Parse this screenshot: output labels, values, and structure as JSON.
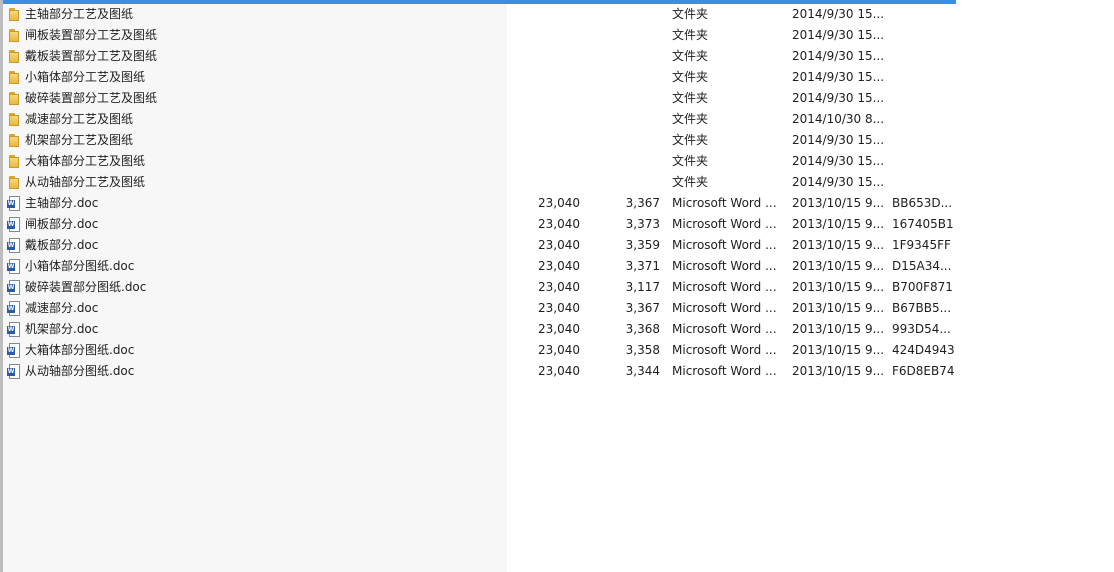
{
  "files": [
    {
      "kind": "folder",
      "icon": "folder-icon",
      "name": "主轴部分工艺及图纸",
      "size": "",
      "packed": "",
      "type": "文件夹",
      "modified": "2014/9/30 15...",
      "crc": ""
    },
    {
      "kind": "folder",
      "icon": "folder-icon",
      "name": "闸板装置部分工艺及图纸",
      "size": "",
      "packed": "",
      "type": "文件夹",
      "modified": "2014/9/30 15...",
      "crc": ""
    },
    {
      "kind": "folder",
      "icon": "folder-icon",
      "name": "戴板装置部分工艺及图纸",
      "size": "",
      "packed": "",
      "type": "文件夹",
      "modified": "2014/9/30 15...",
      "crc": ""
    },
    {
      "kind": "folder",
      "icon": "folder-icon",
      "name": "小箱体部分工艺及图纸",
      "size": "",
      "packed": "",
      "type": "文件夹",
      "modified": "2014/9/30 15...",
      "crc": ""
    },
    {
      "kind": "folder",
      "icon": "folder-icon",
      "name": "破碎装置部分工艺及图纸",
      "size": "",
      "packed": "",
      "type": "文件夹",
      "modified": "2014/9/30 15...",
      "crc": ""
    },
    {
      "kind": "folder",
      "icon": "folder-icon",
      "name": "减速部分工艺及图纸",
      "size": "",
      "packed": "",
      "type": "文件夹",
      "modified": "2014/10/30 8...",
      "crc": ""
    },
    {
      "kind": "folder",
      "icon": "folder-icon",
      "name": "机架部分工艺及图纸",
      "size": "",
      "packed": "",
      "type": "文件夹",
      "modified": "2014/9/30 15...",
      "crc": ""
    },
    {
      "kind": "folder",
      "icon": "folder-icon",
      "name": "大箱体部分工艺及图纸",
      "size": "",
      "packed": "",
      "type": "文件夹",
      "modified": "2014/9/30 15...",
      "crc": ""
    },
    {
      "kind": "folder",
      "icon": "folder-icon",
      "name": "从动轴部分工艺及图纸",
      "size": "",
      "packed": "",
      "type": "文件夹",
      "modified": "2014/9/30 15...",
      "crc": ""
    },
    {
      "kind": "doc",
      "icon": "word-doc-icon",
      "name": "主轴部分.doc",
      "size": "23,040",
      "packed": "3,367",
      "type": "Microsoft Word ...",
      "modified": "2013/10/15 9...",
      "crc": "BB653D..."
    },
    {
      "kind": "doc",
      "icon": "word-doc-icon",
      "name": "闸板部分.doc",
      "size": "23,040",
      "packed": "3,373",
      "type": "Microsoft Word ...",
      "modified": "2013/10/15 9...",
      "crc": "167405B1"
    },
    {
      "kind": "doc",
      "icon": "word-doc-icon",
      "name": "戴板部分.doc",
      "size": "23,040",
      "packed": "3,359",
      "type": "Microsoft Word ...",
      "modified": "2013/10/15 9...",
      "crc": "1F9345FF"
    },
    {
      "kind": "doc",
      "icon": "word-doc-icon",
      "name": "小箱体部分图纸.doc",
      "size": "23,040",
      "packed": "3,371",
      "type": "Microsoft Word ...",
      "modified": "2013/10/15 9...",
      "crc": "D15A34..."
    },
    {
      "kind": "doc",
      "icon": "word-doc-icon",
      "name": "破碎装置部分图纸.doc",
      "size": "23,040",
      "packed": "3,117",
      "type": "Microsoft Word ...",
      "modified": "2013/10/15 9...",
      "crc": "B700F871"
    },
    {
      "kind": "doc",
      "icon": "word-doc-icon",
      "name": "减速部分.doc",
      "size": "23,040",
      "packed": "3,367",
      "type": "Microsoft Word ...",
      "modified": "2013/10/15 9...",
      "crc": "B67BB5..."
    },
    {
      "kind": "doc",
      "icon": "word-doc-icon",
      "name": "机架部分.doc",
      "size": "23,040",
      "packed": "3,368",
      "type": "Microsoft Word ...",
      "modified": "2013/10/15 9...",
      "crc": "993D54..."
    },
    {
      "kind": "doc",
      "icon": "word-doc-icon",
      "name": "大箱体部分图纸.doc",
      "size": "23,040",
      "packed": "3,358",
      "type": "Microsoft Word ...",
      "modified": "2013/10/15 9...",
      "crc": "424D4943"
    },
    {
      "kind": "doc",
      "icon": "word-doc-icon",
      "name": "从动轴部分图纸.doc",
      "size": "23,040",
      "packed": "3,344",
      "type": "Microsoft Word ...",
      "modified": "2013/10/15 9...",
      "crc": "F6D8EB74"
    }
  ],
  "colors": {
    "selection_bar": "#3c8fe0",
    "name_column_bg": "#f7f7f7",
    "text": "#1e1e1e"
  }
}
